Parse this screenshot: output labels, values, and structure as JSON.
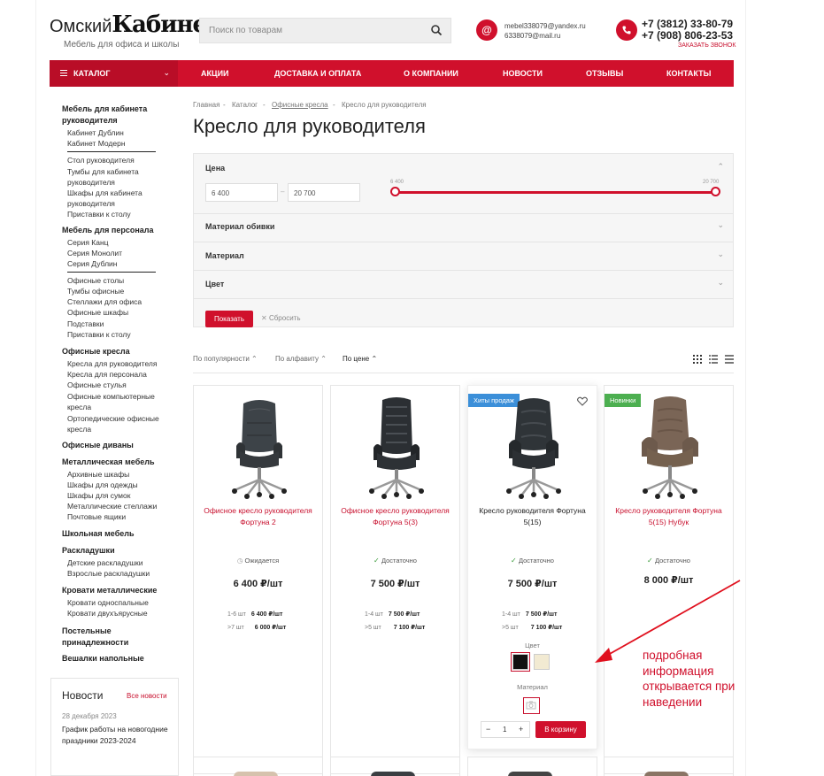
{
  "header": {
    "logo_prefix": "Омский",
    "logo_word": "Кабинет",
    "logo_mark": "m",
    "tagline": "Мебель для офиса и школы",
    "search_placeholder": "Поиск по товарам",
    "email1": "mebel338079@yandex.ru",
    "email2": "6338079@mail.ru",
    "phone1": "+7 (3812) 33-80-79",
    "phone2": "+7 (908) 806-23-53",
    "callback": "ЗАКАЗАТЬ ЗВОНОК"
  },
  "nav": {
    "catalog": "КАТАЛОГ",
    "items": [
      "АКЦИИ",
      "ДОСТАВКА И ОПЛАТА",
      "О КОМПАНИИ",
      "НОВОСТИ",
      "ОТЗЫВЫ",
      "КОНТАКТЫ"
    ]
  },
  "sidebar": {
    "h1": "Мебель для кабинета руководителя",
    "g1": [
      "Кабинет Дублин",
      "Кабинет Модерн",
      "Стол руководителя",
      "Тумбы для кабинета руководителя",
      "Шкафы для кабинета руководителя",
      "Приставки к столу"
    ],
    "h2": "Мебель для персонала",
    "g2": [
      "Серия Канц",
      "Серия Монолит",
      "Серия Дублин",
      "Офисные столы",
      "Тумбы офисные",
      "Стеллажи для офиса",
      "Офисные шкафы",
      "Подставки",
      "Приставки к столу"
    ],
    "h3": "Офисные кресла",
    "g3": [
      "Кресла для руководителя",
      "Кресла для персонала",
      "Офисные стулья",
      "Офисные компьютерные кресла",
      "Ортопедические офисные кресла"
    ],
    "h4": "Офисные диваны",
    "h5": "Металлическая мебель",
    "g5": [
      "Архивные шкафы",
      "Шкафы для одежды",
      "Шкафы для сумок",
      "Металлические стеллажи",
      "Почтовые ящики"
    ],
    "h6": "Школьная мебель",
    "h7": "Раскладушки",
    "g7": [
      "Детские раскладушки",
      "Взрослые раскладушки"
    ],
    "h8": "Кровати металлические",
    "g8": [
      "Кровати односпальные",
      "Кровати двухъярусные"
    ],
    "h9": "Постельные принадлежности",
    "h10": "Вешалки напольные"
  },
  "news": {
    "title": "Новости",
    "all": "Все новости",
    "date": "28 декабря 2023",
    "text": "График работы на новогодние праздники 2023-2024"
  },
  "breadcrumb": [
    "Главная",
    "Каталог",
    "Офисные кресла",
    "Кресло для руководителя"
  ],
  "page_title": "Кресло для руководителя",
  "filters": {
    "price_label": "Цена",
    "price_from": "6 400",
    "price_to": "20 700",
    "range_min": "6 400",
    "range_max": "20 700",
    "upholstery": "Материал обивки",
    "material": "Материал",
    "color": "Цвет",
    "show": "Показать",
    "reset": "Сбросить"
  },
  "sort": {
    "popular": "По популярности",
    "alpha": "По алфавиту",
    "price": "По цене"
  },
  "products": [
    {
      "name": "Офисное кресло руководителя Фортуна 2",
      "stock": "Ожидается",
      "price": "6 400 ₽/шт",
      "t1q": "1-6 шт",
      "t1p": "6 400 ₽/шт",
      "t2q": ">7 шт",
      "t2p": "6 000 ₽/шт"
    },
    {
      "name": "Офисное кресло руководителя Фортуна 5(3)",
      "stock": "Достаточно",
      "price": "7 500 ₽/шт",
      "t1q": "1-4 шт",
      "t1p": "7 500 ₽/шт",
      "t2q": ">5 шт",
      "t2p": "7 100 ₽/шт"
    },
    {
      "badge": "Хиты продаж",
      "name": "Кресло руководителя Фортуна 5(15)",
      "stock": "Достаточно",
      "price": "7 500 ₽/шт",
      "t1q": "1-4 шт",
      "t1p": "7 500 ₽/шт",
      "t2q": ">5 шт",
      "t2p": "7 100 ₽/шт",
      "color_label": "Цвет",
      "material_label": "Материал",
      "qty": "1",
      "add": "В корзину"
    },
    {
      "badge": "Новинки",
      "name": "Кресло руководителя Фортуна 5(15) Нубук",
      "stock": "Достаточно",
      "price": "8 000 ₽/шт"
    }
  ],
  "annotation": "подробная информация открывается при наведении",
  "colors": {
    "accent": "#d0102c",
    "hit_badge": "#3b8fd9",
    "new_badge": "#4caf50",
    "annotation": "#d0102c"
  }
}
